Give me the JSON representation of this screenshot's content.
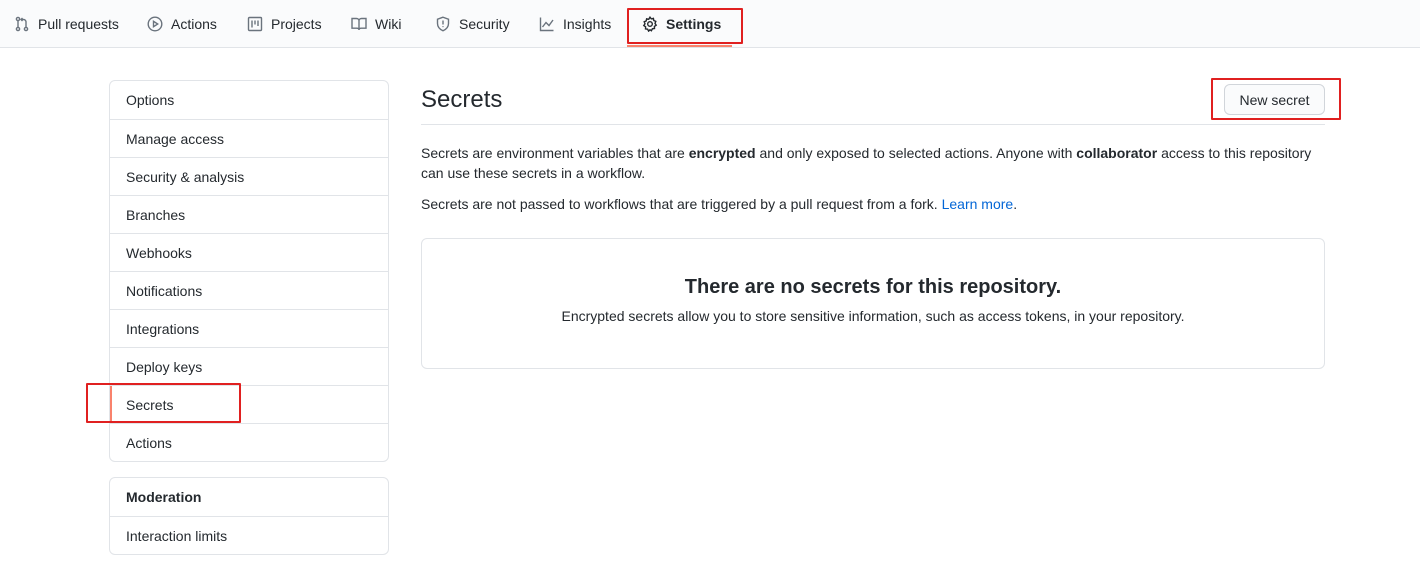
{
  "nav": {
    "tabs": [
      {
        "label": "Pull requests",
        "icon": "git-pull-request-icon"
      },
      {
        "label": "Actions",
        "icon": "play-icon"
      },
      {
        "label": "Projects",
        "icon": "project-icon"
      },
      {
        "label": "Wiki",
        "icon": "book-icon"
      },
      {
        "label": "Security",
        "icon": "shield-icon"
      },
      {
        "label": "Insights",
        "icon": "graph-icon"
      },
      {
        "label": "Settings",
        "icon": "gear-icon",
        "active": true
      }
    ]
  },
  "sidebar": {
    "items": [
      {
        "label": "Options"
      },
      {
        "label": "Manage access"
      },
      {
        "label": "Security & analysis"
      },
      {
        "label": "Branches"
      },
      {
        "label": "Webhooks"
      },
      {
        "label": "Notifications"
      },
      {
        "label": "Integrations"
      },
      {
        "label": "Deploy keys"
      },
      {
        "label": "Secrets",
        "selected": true
      },
      {
        "label": "Actions"
      }
    ],
    "moderation": {
      "heading": "Moderation",
      "items": [
        {
          "label": "Interaction limits"
        }
      ]
    }
  },
  "main": {
    "title": "Secrets",
    "new_button": "New secret",
    "desc1": {
      "p1": "Secrets are environment variables that are ",
      "b1": "encrypted",
      "p2": " and only exposed to selected actions. Anyone with ",
      "b2": "collaborator",
      "p3": " access to this repository can use these secrets in a workflow."
    },
    "desc2": {
      "text": "Secrets are not passed to workflows that are triggered by a pull request from a fork. ",
      "link": "Learn more",
      "end": "."
    },
    "blankslate": {
      "title": "There are no secrets for this repository.",
      "subtitle": "Encrypted secrets allow you to store sensitive information, such as access tokens, in your repository."
    }
  },
  "colors": {
    "accent_underline": "#f9826c",
    "link": "#0366d6",
    "annotation": "#e02020",
    "border": "#e1e4e8"
  }
}
